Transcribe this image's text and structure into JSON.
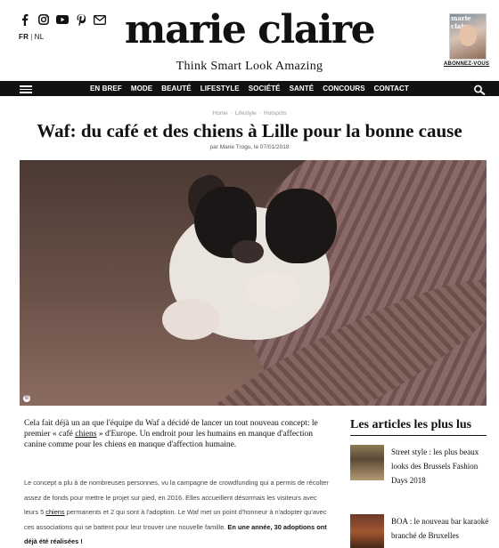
{
  "header": {
    "social_icons": [
      "facebook-icon",
      "instagram-icon",
      "youtube-icon",
      "pinterest-icon",
      "mail-icon"
    ],
    "lang_active": "FR",
    "lang_sep": "|",
    "lang_other": "NL",
    "logo": "marie claire",
    "tagline": "Think Smart Look Amazing",
    "magazine_title": "marie claire",
    "subscribe_label": "ABONNEZ-VOUS"
  },
  "nav": {
    "items": [
      "EN BREF",
      "MODE",
      "BEAUTÉ",
      "LIFESTYLE",
      "SOCIÉTÉ",
      "SANTÉ",
      "CONCOURS",
      "CONTACT"
    ]
  },
  "breadcrumb": [
    "Home",
    "Lifestyle",
    "Hotspots"
  ],
  "article": {
    "title": "Waf: du café et des chiens à Lille pour la bonne cause",
    "byline": "par Marie Trogu, le 07/01/2018",
    "lead_1": "Cela fait déjà un an que l'équipe du Waf a décidé de lancer un tout nouveau concept: le premier « café ",
    "lead_link": "chiens",
    "lead_2": " » d'Europe. Un endroit pour les humains en manque d'affection canine comme pour les chiens en manque d'affection humaine.",
    "body_1": "Le concept a plu à de nombreuses personnes, vu la campagne de crowdfunding qui a permis de récolter assez de fonds pour mettre le projet sur pied, en 2016. Elles accueillent désormais les visiteurs avec leurs 5 ",
    "body_link": "chiens",
    "body_2": " permanents et 2 qui sont à l'adoption. Le Waf met un point d'honneur à n'adopter qu'avec ces associations qui se battent pour leur trouver une nouvelle famille. ",
    "body_bold": "En une année, 30 adoptions ont déjà été réalisées !",
    "photo_credit": "©"
  },
  "sidebar": {
    "title": "Les articles les plus lus",
    "items": [
      {
        "text": "Street style : les plus beaux looks des Brussels Fashion Days 2018"
      },
      {
        "text": "BOA : le nouveau bar karaoké branché de Bruxelles"
      }
    ]
  }
}
